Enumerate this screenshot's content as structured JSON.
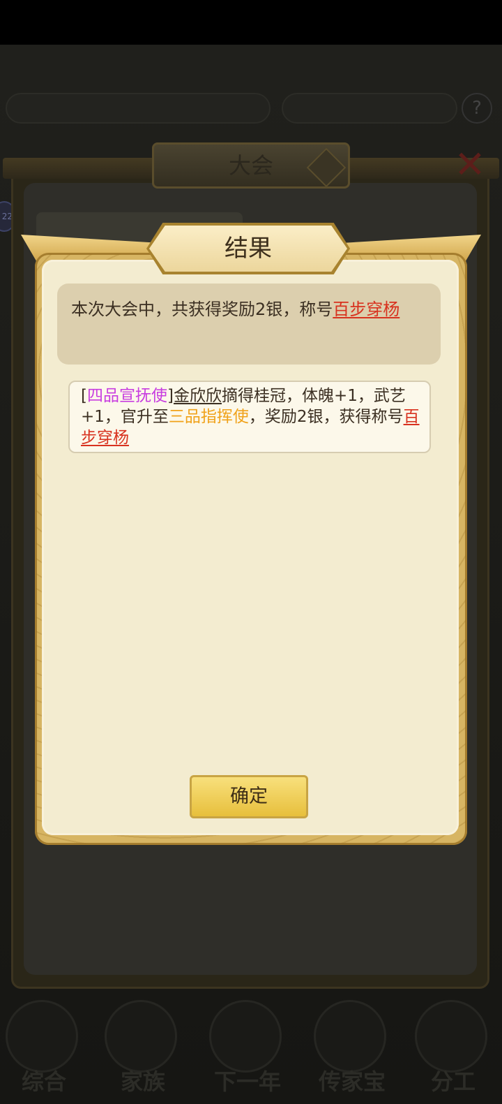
{
  "dialog": {
    "title": "结果",
    "summary": {
      "text": "本次大会中，共获得奖励2银，称号",
      "title_link": "百步穿杨"
    },
    "result": {
      "bracket_open": "[",
      "rank": "四品宣抚使",
      "bracket_close": "]",
      "name": "金欣欣",
      "text1": "摘得桂冠，体魄+1，武艺+1，官升至",
      "new_rank": "三品指挥使",
      "text2": "，奖励2银，获得称号",
      "title_link": "百步穿杨"
    },
    "confirm_label": "确定"
  },
  "background": {
    "panel_title": "大会",
    "close_glyph": "✕",
    "help_glyph": "?",
    "badge": "22"
  },
  "nav": {
    "items": [
      "综合",
      "家族",
      "下一年",
      "传家宝",
      "分工"
    ]
  },
  "colors": {
    "red_link": "#d8321f",
    "purple_rank": "#c83de0",
    "orange_rank": "#f0a21a",
    "button_gold": "#f0d060"
  }
}
